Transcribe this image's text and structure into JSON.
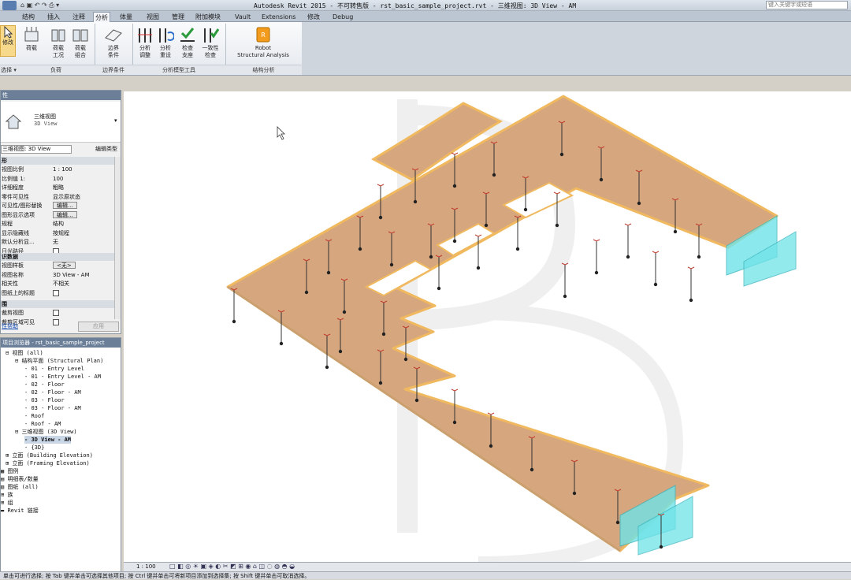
{
  "titlebar": {
    "title": "Autodesk Revit 2015 - 不可转售版 -    rst_basic_sample_project.rvt - 三维视图: 3D View - AM",
    "search_placeholder": "键入关键字或短语"
  },
  "tabs": [
    "结构",
    "插入",
    "注释",
    "分析",
    "体量",
    "视图",
    "管理",
    "附加模块",
    "Vault",
    "Extensions",
    "修改",
    "Debug"
  ],
  "active_tab": 3,
  "ribbon": {
    "modify": "修改",
    "select": "选择 ▾",
    "loads": "荷载",
    "load_cases": [
      "荷载",
      "工况"
    ],
    "load_combos": [
      "荷载",
      "组合"
    ],
    "boundary": [
      "边界",
      "条件"
    ],
    "analytic_adjust": [
      "分析",
      "调整"
    ],
    "analytic_reset": [
      "分析",
      "重设"
    ],
    "check_supports": [
      "检查",
      "支座"
    ],
    "consistency": [
      "一致性",
      "检查"
    ],
    "robot": [
      "Robot",
      "Structural Analysis"
    ],
    "panel_loads": "负荷",
    "panel_boundary": "边界条件",
    "panel_tools": "分析模型工具",
    "panel_analysis": "结构分析"
  },
  "properties": {
    "header": "性",
    "type_name": "三维视图",
    "type_sub": "3D View",
    "selector": "三维视图: 3D View",
    "edit_type": "编辑类型",
    "group_graphics": "形",
    "group_ids": "识数据",
    "group_extents": "围",
    "apply": "应用",
    "help": "性帮助",
    "rows": [
      {
        "k": "视图比例",
        "v": "1 : 100"
      },
      {
        "k": "比例值 1:",
        "v": "100"
      },
      {
        "k": "详细程度",
        "v": "粗略"
      },
      {
        "k": "零件可见性",
        "v": "显示原状态"
      },
      {
        "k": "可见性/图形替换",
        "v": "编辑..."
      },
      {
        "k": "图形显示选项",
        "v": "编辑..."
      },
      {
        "k": "规程",
        "v": "结构"
      },
      {
        "k": "显示隐藏线",
        "v": "按规程"
      },
      {
        "k": "默认分析显...",
        "v": "无"
      },
      {
        "k": "日光路径",
        "v": ""
      }
    ],
    "rows2": [
      {
        "k": "视图样板",
        "v": "<无>"
      },
      {
        "k": "视图名称",
        "v": "3D View - AM"
      },
      {
        "k": "相关性",
        "v": "不相关"
      },
      {
        "k": "图纸上的标题",
        "v": ""
      }
    ],
    "rows3": [
      {
        "k": "裁剪视图",
        "v": ""
      },
      {
        "k": "裁剪区域可见",
        "v": ""
      }
    ]
  },
  "browser": {
    "header": "项目浏览器 - rst_basic_sample_project",
    "items": [
      "视图 (all)",
      "结构平面 (Structural Plan)",
      "01 - Entry Level",
      "01 - Entry Level - AM",
      "02 - Floor",
      "02 - Floor - AM",
      "03 - Floor",
      "03 - Floor - AM",
      "Roof",
      "Roof - AM",
      "三维视图 (3D View)",
      "3D View - AM",
      "{3D}",
      "立面 (Building Elevation)",
      "立面 (Framing Elevation)",
      "图例",
      "明细表/数量",
      "图纸 (all)",
      "族",
      "组",
      "Revit 链接"
    ]
  },
  "statusbar": {
    "scale": "1 : 100"
  },
  "bottombar": {
    "hint": "单击可进行选择; 按 Tab 键并单击可选择其他项目; 按 Ctrl 键并单击可将新项目添加到选择集; 按 Shift 键并单击可取消选择。"
  },
  "colors": {
    "slab": "#d6a67e",
    "edge": "#f0b95f",
    "glass": "#6fe3e8"
  }
}
